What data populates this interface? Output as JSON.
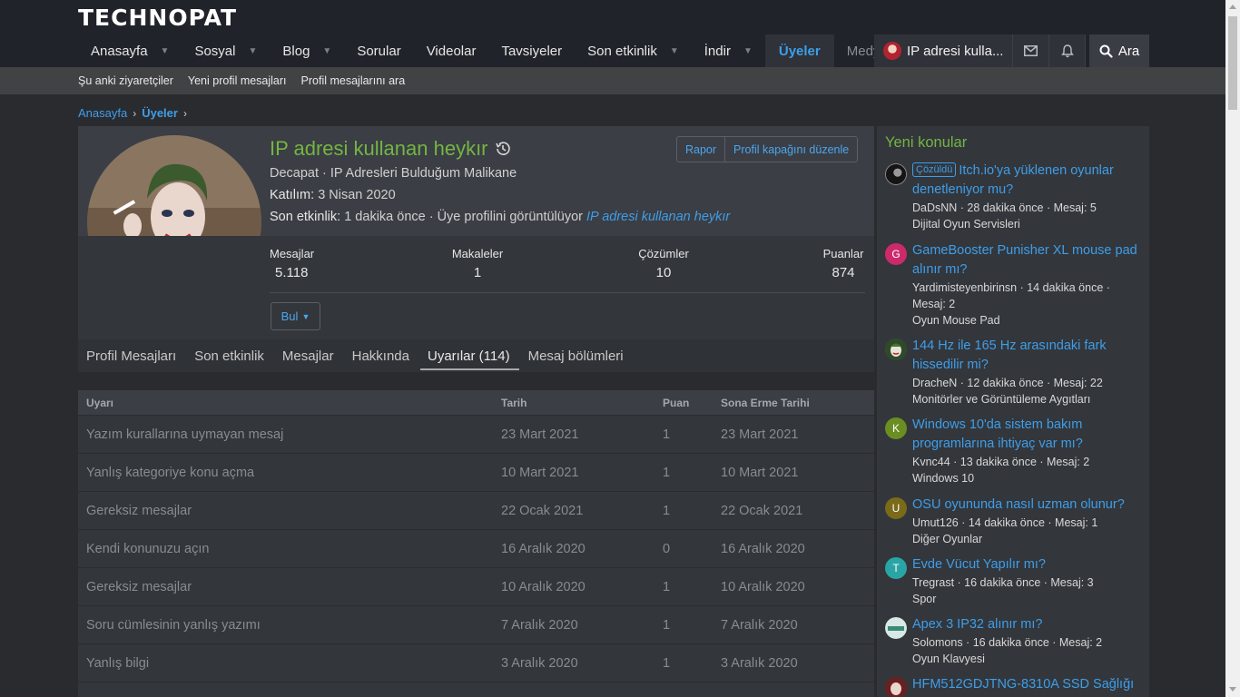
{
  "site": {
    "logo": "TECHNOPAT"
  },
  "nav": {
    "items": [
      {
        "label": "Anasayfa",
        "caret": true
      },
      {
        "label": "Sosyal",
        "caret": true
      },
      {
        "label": "Blog",
        "caret": true
      },
      {
        "label": "Sorular",
        "caret": false
      },
      {
        "label": "Videolar",
        "caret": false
      },
      {
        "label": "Tavsiyeler",
        "caret": false
      },
      {
        "label": "Son etkinlik",
        "caret": true
      },
      {
        "label": "İndir",
        "caret": true
      }
    ],
    "active": "Üyeler",
    "overflow": "Medya",
    "user_label": "IP adresi kulla...",
    "search_label": "Ara"
  },
  "subnav": [
    "Şu anki ziyaretçiler",
    "Yeni profil mesajları",
    "Profil mesajlarını ara"
  ],
  "breadcrumb": [
    "Anasayfa",
    "Üyeler"
  ],
  "profile": {
    "name": "IP adresi kullanan heykır",
    "line1": "Decapat · IP Adresleri Bulduğum Malikane",
    "joined_label": "Katılım:",
    "joined_value": "3 Nisan 2020",
    "activity_label": "Son etkinlik:",
    "activity_value": "1 dakika önce · Üye profilini görüntülüyor",
    "activity_link": "IP adresi kullanan heykır",
    "buttons": [
      "Rapor",
      "Profil kapağını düzenle"
    ],
    "stats": [
      {
        "label": "Mesajlar",
        "value": "5.118"
      },
      {
        "label": "Makaleler",
        "value": "1"
      },
      {
        "label": "Çözümler",
        "value": "10"
      },
      {
        "label": "Puanlar",
        "value": "874"
      }
    ],
    "find_label": "Bul"
  },
  "tabs": [
    "Profil Mesajları",
    "Son etkinlik",
    "Mesajlar",
    "Hakkında",
    "Uyarılar (114)",
    "Mesaj bölümleri"
  ],
  "active_tab": "Uyarılar (114)",
  "warnings": {
    "headers": [
      "Uyarı",
      "Tarih",
      "Puan",
      "Sona Erme Tarihi"
    ],
    "rows": [
      [
        "Yazım kurallarına uymayan mesaj",
        "23 Mart 2021",
        "1",
        "23 Mart 2021"
      ],
      [
        "Yanlış kategoriye konu açma",
        "10 Mart 2021",
        "1",
        "10 Mart 2021"
      ],
      [
        "Gereksiz mesajlar",
        "22 Ocak 2021",
        "1",
        "22 Ocak 2021"
      ],
      [
        "Kendi konunuzu açın",
        "16 Aralık 2020",
        "0",
        "16 Aralık 2020"
      ],
      [
        "Gereksiz mesajlar",
        "10 Aralık 2020",
        "1",
        "10 Aralık 2020"
      ],
      [
        "Soru cümlesinin yanlış yazımı",
        "7 Aralık 2020",
        "1",
        "7 Aralık 2020"
      ],
      [
        "Yanlış bilgi",
        "3 Aralık 2020",
        "1",
        "3 Aralık 2020"
      ]
    ]
  },
  "sidebar": {
    "title": "Yeni konular",
    "threads": [
      {
        "badge": "Çözüldü",
        "title": "Itch.io'ya yüklenen oyunlar denetleniyor mu?",
        "meta": "DaDsNN · 28 dakika önce · Mesaj: 5",
        "forum": "Dijital Oyun Servisleri",
        "avatar": "",
        "color": "#111111"
      },
      {
        "badge": "",
        "title": "GameBooster Punisher XL mouse pad alınır mı?",
        "meta": "Yardimisteyenbirinsn · 14 dakika önce · Mesaj: 2",
        "forum": "Oyun Mouse Pad",
        "avatar": "G",
        "color": "#cc2a6b"
      },
      {
        "badge": "",
        "title": "144 Hz ile 165 Hz arasındaki fark hissedilir mi?",
        "meta": "DracheN · 12 dakika önce · Mesaj: 22",
        "forum": "Monitörler ve Görüntüleme Aygıtları",
        "avatar": "",
        "color": "#3a6a2a"
      },
      {
        "badge": "",
        "title": "Windows 10'da sistem bakım programlarına ihtiyaç var mı?",
        "meta": "Kvnc44 · 13 dakika önce · Mesaj: 2",
        "forum": "Windows 10",
        "avatar": "K",
        "color": "#6b8e23"
      },
      {
        "badge": "",
        "title": "OSU oyununda nasıl uzman olunur?",
        "meta": "Umut126 · 14 dakika önce · Mesaj: 1",
        "forum": "Diğer Oyunlar",
        "avatar": "U",
        "color": "#7a6a1a"
      },
      {
        "badge": "",
        "title": "Evde Vücut Yapılır mı?",
        "meta": "Tregrast · 16 dakika önce · Mesaj: 3",
        "forum": "Spor",
        "avatar": "T",
        "color": "#2aa5a5"
      },
      {
        "badge": "",
        "title": "Apex 3 IP32 alınır mı?",
        "meta": "Solomons · 16 dakika önce · Mesaj: 2",
        "forum": "Oyun Klavyesi",
        "avatar": "",
        "color": "#4a8a7a"
      },
      {
        "badge": "",
        "title": "HFM512GDJTNG-8310A SSD Sağlığı",
        "meta": "",
        "forum": "",
        "avatar": "",
        "color": "#8a2a2a"
      }
    ]
  }
}
